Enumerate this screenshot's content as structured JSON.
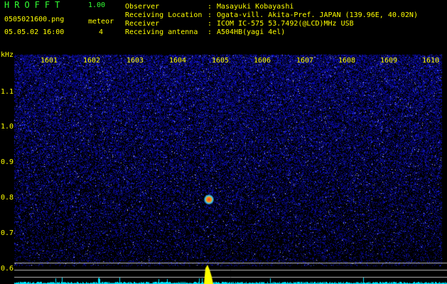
{
  "header": {
    "app_title": "HROFFT",
    "version": "1.00",
    "filename": "0505021600.png",
    "meteor_label": "meteor",
    "datetime": "05.05.02 16:00",
    "meteor_count": "4",
    "info": [
      {
        "label": "Observer",
        "value": "Masayuki Kobayashi"
      },
      {
        "label": "Receiving Location",
        "value": "Ogata-vill. Akita-Pref. JAPAN (139.96E, 40.02N)"
      },
      {
        "label": "Receiver",
        "value": "ICOM IC-575 53.7492(@LCD)MHz USB"
      },
      {
        "label": "Receiving antenna",
        "value": "A504HB(yagi 4el)"
      }
    ]
  },
  "plot": {
    "y_unit": "kHz",
    "y_ticks": [
      "1.1",
      "1.0",
      "0.9",
      "0.8",
      "0.7",
      "0.6"
    ],
    "x_ticks": [
      "1601",
      "1602",
      "1603",
      "1604",
      "1605",
      "1606",
      "1607",
      "1608",
      "1609",
      "1610"
    ],
    "colors": {
      "background": "#000000",
      "noise": "#1e1ec8",
      "text": "#ffff00",
      "spectrum": "#00e5ff",
      "echo_peak": "#ffff00"
    }
  }
}
